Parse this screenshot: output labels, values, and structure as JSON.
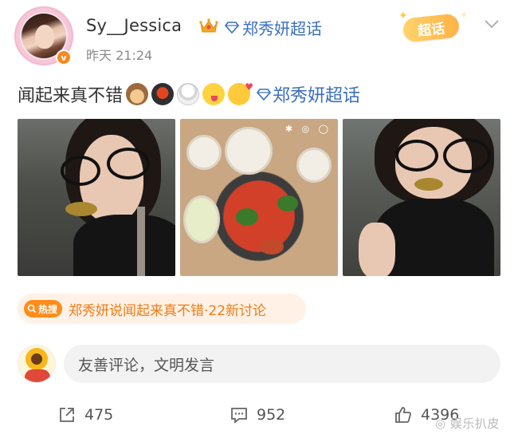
{
  "post": {
    "username": "Sy__Jessica",
    "supertopic_label": "郑秀妍超话",
    "timestamp": "昨天 21:24",
    "text": "闻起来真不错",
    "text_link": "郑秀妍超话",
    "badge_label": "超话",
    "verified_mark": "v",
    "emojis": [
      "monkey-icon",
      "hotpot-icon",
      "rice-bowl-icon",
      "yum-face-icon",
      "love-face-icon"
    ]
  },
  "hot_search": {
    "tag": "热搜",
    "text": "郑秀妍说闻起来真不错·22新讨论"
  },
  "comment": {
    "placeholder": "友善评论，文明发言"
  },
  "actions": {
    "repost_count": "475",
    "comment_count": "952",
    "like_count": "4396"
  },
  "watermark": "娱乐扒皮",
  "colors": {
    "link_blue": "#3b6fbf",
    "hot_orange": "#ff8c1a",
    "hot_bg": "#fff1e6",
    "verified_orange": "#f78a1d"
  }
}
